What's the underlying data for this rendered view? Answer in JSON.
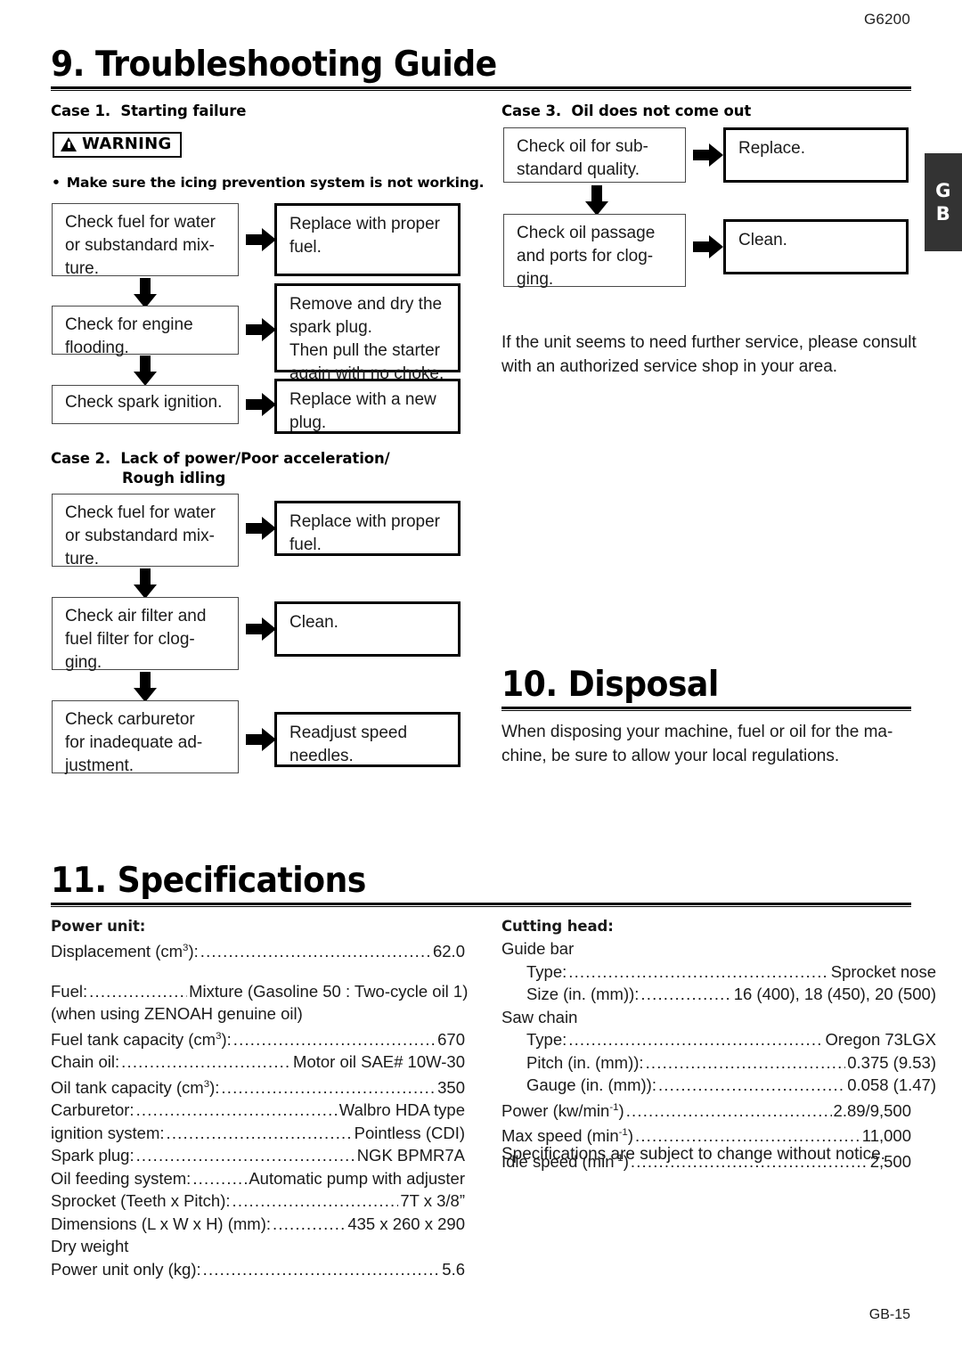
{
  "header": {
    "model_code": "G6200"
  },
  "side_tab": {
    "line1": "G",
    "line2": "B"
  },
  "footer": {
    "page": "GB-15"
  },
  "sections": {
    "troubleshooting": {
      "title": "9. Troubleshooting Guide"
    },
    "disposal": {
      "title": "10. Disposal",
      "body": "When disposing your machine, fuel or oil for the ma-\nchine, be sure to allow your local regulations."
    },
    "specifications": {
      "title": "11. Specifications"
    }
  },
  "case1": {
    "title": "Case 1.  Starting failure",
    "warning_label": "WARNING",
    "warning_bullet": "Make sure the icing prevention system is not working.",
    "steps": [
      {
        "check": "Check fuel for water\nor substandard mix-\nture.",
        "action": "Replace with proper\nfuel."
      },
      {
        "check": "Check  for  engine\nflooding.",
        "action": "Remove and dry the\nspark plug.\nThen pull the starter\nagain with no choke."
      },
      {
        "check": "Check spark ignition.",
        "action": "Replace with a new\nplug."
      }
    ]
  },
  "case2": {
    "title_line1": "Case 2.  Lack of power/Poor acceleration/",
    "title_line2": "Rough idling",
    "steps": [
      {
        "check": "Check fuel for water\nor substandard mix-\nture.",
        "action": "Replace with proper\nfuel."
      },
      {
        "check": "Check air filter and\nfuel  filter  for  clog-\nging.",
        "action": "Clean."
      },
      {
        "check": "Check  carburetor\nfor inadequate ad-\njustment.",
        "action": "Readjust speed\nneedles."
      }
    ]
  },
  "case3": {
    "title": "Case 3.  Oil does not come out",
    "steps": [
      {
        "check": "Check  oil  for  sub-\nstandard quality.",
        "action": "Replace."
      },
      {
        "check": "Check oil passage\nand ports for clog-\nging.",
        "action": "Clean."
      }
    ],
    "note": "If the unit seems to need further service, please consult\nwith an authorized service shop in your area."
  },
  "specs": {
    "power_unit": {
      "heading": "Power unit:",
      "rows": [
        {
          "label": "Displacement (cm",
          "sup": "3",
          "label_tail": "):",
          "value": "62.0",
          "leader": true
        },
        {
          "type": "gap"
        },
        {
          "label": "Fuel:",
          "value": "Mixture (Gasoline 50 : Two-cycle oil 1)",
          "leader": true,
          "short_leader": true
        },
        {
          "type": "plain",
          "text": "(when using  ZENOAH genuine oil)"
        },
        {
          "label": "Fuel tank capacity (cm",
          "sup": "3",
          "label_tail": "):",
          "value": "670",
          "leader": true
        },
        {
          "label": "Chain oil:",
          "value": "Motor oil SAE# 10W-30",
          "leader": true
        },
        {
          "label": "Oil tank capacity (cm",
          "sup": "3",
          "label_tail": "):",
          "value": "350",
          "leader": true
        },
        {
          "label": "Carburetor:",
          "value": "Walbro HDA type",
          "leader": true
        },
        {
          "label": "ignition system:",
          "value": "Pointless (CDI)",
          "leader": true
        },
        {
          "label": "Spark plug:",
          "value": "NGK BPMR7A",
          "leader": true
        },
        {
          "label": "Oil feeding system:",
          "value": "Automatic pump with adjuster",
          "leader": true
        },
        {
          "label": "Sprocket (Teeth x Pitch):",
          "value": "7T x 3/8”",
          "leader": true
        },
        {
          "label": "Dimensions (L x W x H) (mm):",
          "value": "435 x 260 x 290",
          "leader": true
        },
        {
          "type": "plain",
          "text": "Dry weight"
        },
        {
          "label": "Power unit only (kg):",
          "value": "5.6",
          "leader": true
        }
      ]
    },
    "cutting_head": {
      "heading": "Cutting head:",
      "rows": [
        {
          "type": "plain",
          "text": "Guide bar"
        },
        {
          "label": "Type:",
          "value": "Sprocket nose",
          "leader": true,
          "indent": true
        },
        {
          "label": "Size (in. (mm)):",
          "value": "16 (400), 18 (450), 20 (500)",
          "leader": true,
          "indent": true
        },
        {
          "type": "plain",
          "text": "Saw chain"
        },
        {
          "label": "Type:",
          "value": "Oregon 73LGX",
          "leader": true,
          "indent": true
        },
        {
          "label": "Pitch (in. (mm)):",
          "value": "0.375 (9.53)",
          "leader": true,
          "indent": true
        },
        {
          "label": "Gauge (in. (mm)):",
          "value": "0.058 (1.47)",
          "leader": true,
          "indent": true
        },
        {
          "label": "Power (kw/min",
          "sup": "-1",
          "label_tail": ")",
          "value": "2.89/9,500",
          "leader": true
        },
        {
          "label": "Max speed (min",
          "sup": "-1",
          "label_tail": ")",
          "value": "11,000",
          "leader": true
        },
        {
          "label": "Idle speed (min",
          "sup": "-1",
          "label_tail": ")",
          "value": "2,500",
          "leader": true
        }
      ],
      "note": "Specifications are subject to change without notice."
    }
  }
}
